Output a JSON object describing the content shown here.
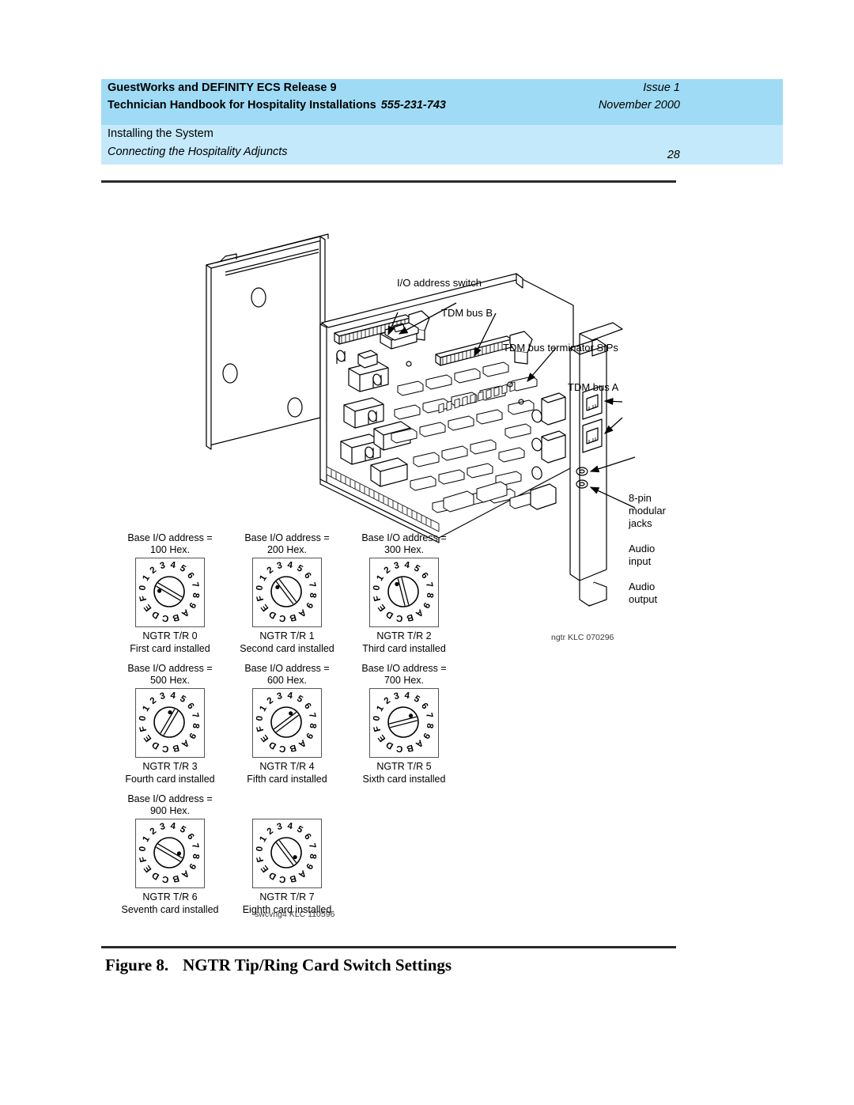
{
  "header": {
    "title_line1": "GuestWorks and DEFINITY ECS Release 9",
    "title_line2": "Technician Handbook for Hospitality Installations",
    "doc_number": "555-231-743",
    "issue": "Issue 1",
    "date": "November 2000",
    "section": "Installing the System",
    "subsection": "Connecting the Hospitality Adjuncts",
    "page_number": "28",
    "band_top_color": "#9FDBF5",
    "band_bottom_color": "#C4E9FB"
  },
  "figure": {
    "caption_number": "Figure 8.",
    "caption_title": "NGTR Tip/Ring Card Switch Settings"
  },
  "illustration": {
    "callouts": [
      {
        "id": "io-address-switch",
        "text": "I/O address switch"
      },
      {
        "id": "tdm-bus-b",
        "text": "TDM bus B"
      },
      {
        "id": "tdm-bus-terminator-sips",
        "text": "TDM bus terminator SIPs"
      },
      {
        "id": "tdm-bus-a",
        "text": "TDM bus A"
      }
    ],
    "jack_label_line1": "8-pin",
    "jack_label_line2": "modular",
    "jack_label_line3": "jacks",
    "audio_input_line1": "Audio",
    "audio_input_line2": "input",
    "audio_output_line1": "Audio",
    "audio_output_line2": "output",
    "drawing_id_card": "ngtr KLC 070296",
    "drawing_id_switches": "swcvng4 KLC 110596"
  },
  "switches": {
    "dial_characters": "0123456789ABCDEF",
    "address_prefix": "Base I/O address =",
    "rows": [
      [
        {
          "address": "100 Hex.",
          "name": "NGTR T/R 0",
          "order": "First card installed",
          "setting": 1
        },
        {
          "address": "200 Hex.",
          "name": "NGTR T/R 1",
          "order": "Second card installed",
          "setting": 2
        },
        {
          "address": "300 Hex.",
          "name": "NGTR T/R 2",
          "order": "Third card installed",
          "setting": 3
        }
      ],
      [
        {
          "address": "500 Hex.",
          "name": "NGTR T/R 3",
          "order": "Fourth card installed",
          "setting": 5
        },
        {
          "address": "600 Hex.",
          "name": "NGTR T/R 4",
          "order": "Fifth card installed",
          "setting": 6
        },
        {
          "address": "700 Hex.",
          "name": "NGTR T/R 5",
          "order": "Sixth card installed",
          "setting": 7
        }
      ],
      [
        {
          "address": "900 Hex.",
          "name": "NGTR T/R 6",
          "order": "Seventh card installed",
          "setting": 9
        },
        {
          "address": "",
          "name": "NGTR T/R 7",
          "order": "Eighth card installed",
          "setting": 10
        }
      ]
    ]
  }
}
